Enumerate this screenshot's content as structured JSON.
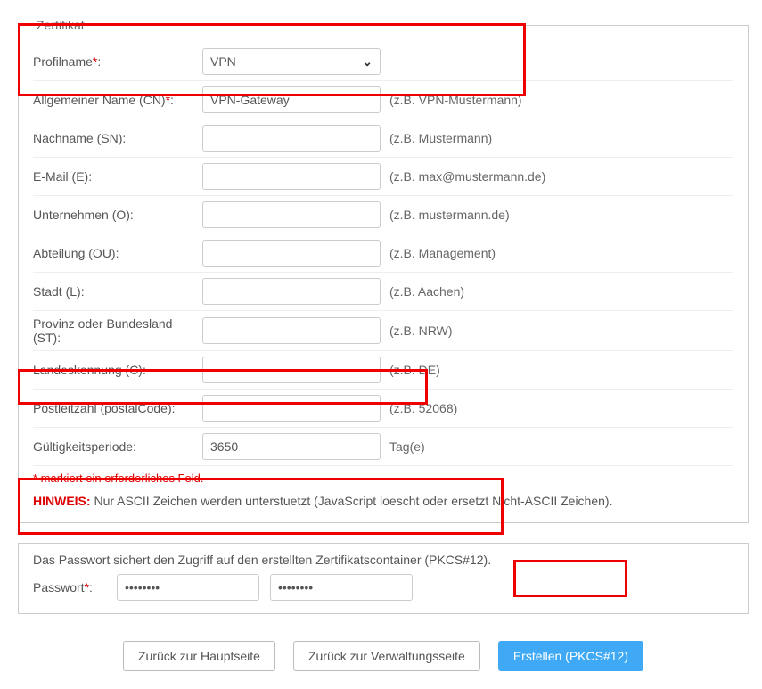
{
  "fieldset": {
    "legend": "Zertifikat",
    "rows": [
      {
        "label": "Profilname",
        "required": true,
        "type": "select",
        "value": "VPN",
        "hint": ""
      },
      {
        "label": "Allgemeiner Name (CN)",
        "required": true,
        "type": "text",
        "value": "VPN-Gateway",
        "hint": "(z.B. VPN-Mustermann)"
      },
      {
        "label": "Nachname (SN):",
        "required": false,
        "type": "text",
        "value": "",
        "hint": "(z.B. Mustermann)"
      },
      {
        "label": "E-Mail (E):",
        "required": false,
        "type": "text",
        "value": "",
        "hint": "(z.B. max@mustermann.de)"
      },
      {
        "label": "Unternehmen (O):",
        "required": false,
        "type": "text",
        "value": "",
        "hint": "(z.B. mustermann.de)"
      },
      {
        "label": "Abteilung (OU):",
        "required": false,
        "type": "text",
        "value": "",
        "hint": "(z.B. Management)"
      },
      {
        "label": "Stadt (L):",
        "required": false,
        "type": "text",
        "value": "",
        "hint": "(z.B. Aachen)"
      },
      {
        "label": "Provinz oder Bundesland (ST):",
        "required": false,
        "type": "text",
        "value": "",
        "hint": "(z.B. NRW)"
      },
      {
        "label": "Landeskennung (C):",
        "required": false,
        "type": "text",
        "value": "",
        "hint": "(z.B. DE)"
      },
      {
        "label": "Postleitzahl (postalCode):",
        "required": false,
        "type": "text",
        "value": "",
        "hint": "(z.B. 52068)"
      },
      {
        "label": "Gültigkeitsperiode:",
        "required": false,
        "type": "text",
        "value": "3650",
        "hint": "Tag(e)"
      }
    ],
    "note_required": "* markiert ein erforderliches Feld.",
    "hinweis_label": "HINWEIS:",
    "hinweis_text": " Nur ASCII Zeichen werden unterstuetzt (JavaScript loescht oder ersetzt Nicht-ASCII Zeichen)."
  },
  "password_section": {
    "description": "Das Passwort sichert den Zugriff auf den erstellten Zertifikatscontainer (PKCS#12).",
    "label": "Passwort",
    "required": true,
    "value1": "••••••••",
    "value2": "••••••••"
  },
  "buttons": {
    "back_main": "Zurück zur Hauptseite",
    "back_admin": "Zurück zur Verwaltungsseite",
    "create": "Erstellen (PKCS#12)"
  }
}
